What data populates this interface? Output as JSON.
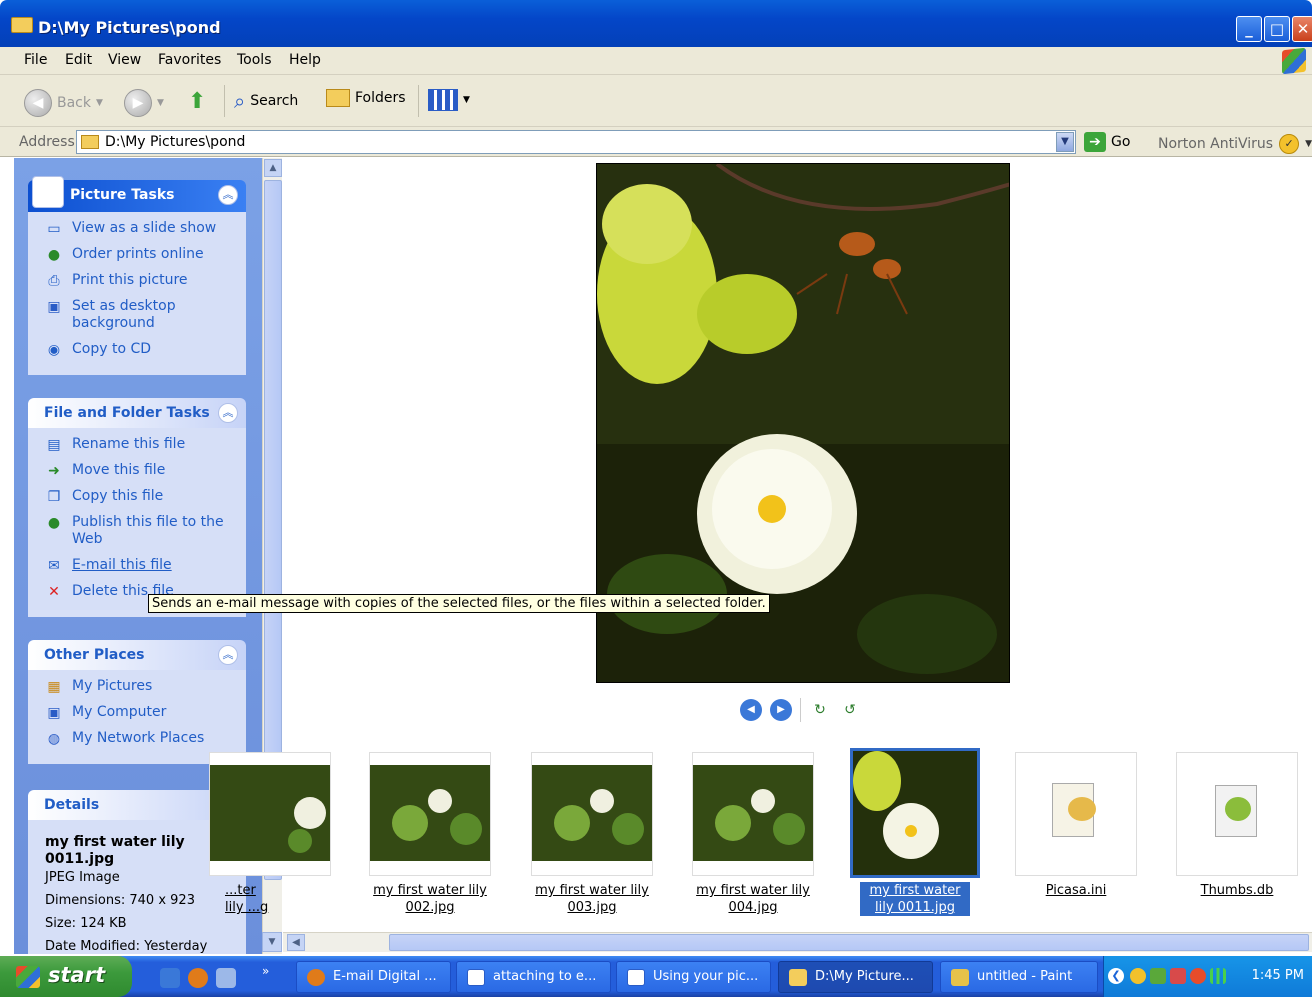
{
  "window": {
    "title": "D:\\My Pictures\\pond"
  },
  "menu": [
    "File",
    "Edit",
    "View",
    "Favorites",
    "Tools",
    "Help"
  ],
  "toolbar": {
    "back": "Back",
    "search": "Search",
    "folders": "Folders"
  },
  "address": {
    "label": "Address",
    "path": "D:\\My Pictures\\pond",
    "go": "Go",
    "norton": "Norton AntiVirus"
  },
  "picture_tasks": {
    "title": "Picture Tasks",
    "items": [
      "View as a slide show",
      "Order prints online",
      "Print this picture",
      "Set as desktop background",
      "Copy to CD"
    ]
  },
  "file_tasks": {
    "title": "File and Folder Tasks",
    "items": [
      "Rename this file",
      "Move this file",
      "Copy this file",
      "Publish this file to the Web",
      "E-mail this file",
      "Delete this file"
    ]
  },
  "other_places": {
    "title": "Other Places",
    "items": [
      "My Pictures",
      "My Computer",
      "My Network Places"
    ]
  },
  "details": {
    "title": "Details",
    "name": "my first water lily 0011.jpg",
    "type": "JPEG Image",
    "dimensions": "Dimensions: 740 x 923",
    "size": "Size: 124 KB",
    "modified": "Date Modified: Yesterday"
  },
  "tooltip": "Sends an e-mail message with copies of the selected files, or the files within a selected folder.",
  "filmstrip": [
    {
      "label": "...ter lily ...g"
    },
    {
      "label": "my first water lily 002.jpg"
    },
    {
      "label": "my first water lily 003.jpg"
    },
    {
      "label": "my first water lily 004.jpg"
    },
    {
      "label": "my first water lily 0011.jpg",
      "selected": true
    },
    {
      "label": "Picasa.ini"
    },
    {
      "label": "Thumbs.db"
    }
  ],
  "taskbar": {
    "start": "start",
    "tasks": [
      "E-mail Digital ...",
      "attaching to e...",
      "Using your pic...",
      "D:\\My Picture...",
      "untitled - Paint"
    ],
    "clock": "1:45 PM"
  }
}
